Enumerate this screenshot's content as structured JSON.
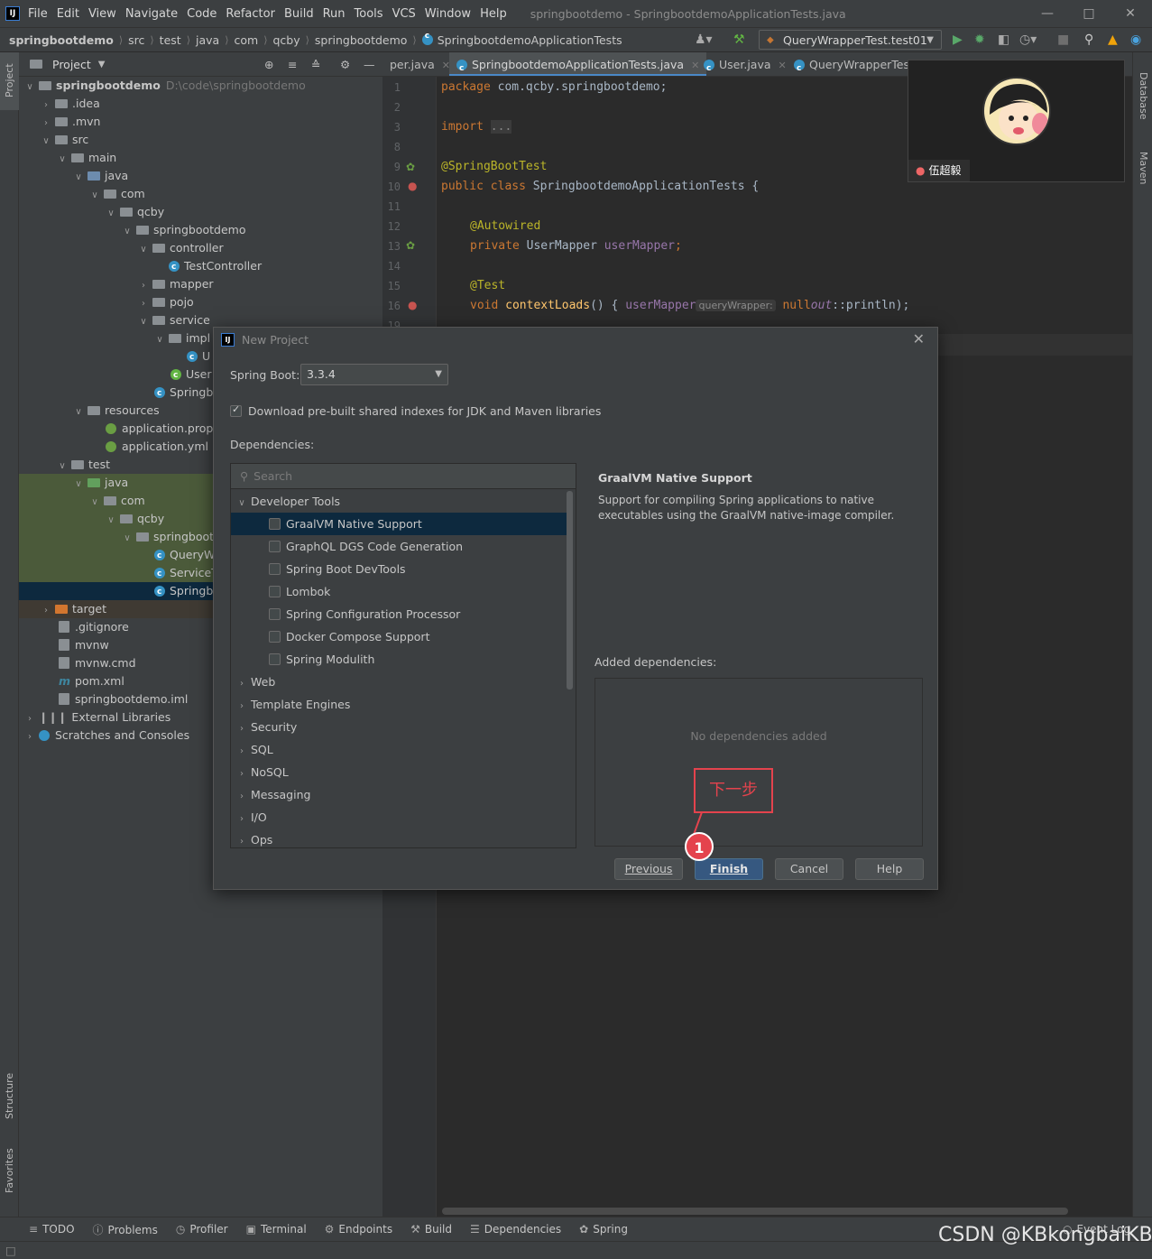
{
  "menubar": {
    "items": [
      "File",
      "Edit",
      "View",
      "Navigate",
      "Code",
      "Refactor",
      "Build",
      "Run",
      "Tools",
      "VCS",
      "Window",
      "Help"
    ],
    "window_title": "springbootdemo - SpringbootdemoApplicationTests.java"
  },
  "navbar": {
    "crumbs": [
      "springbootdemo",
      "src",
      "test",
      "java",
      "com",
      "qcby",
      "springbootdemo",
      "SpringbootdemoApplicationTests"
    ],
    "run_config": "QueryWrapperTest.test01"
  },
  "stripes": {
    "project": "Project",
    "structure": "Structure",
    "favorites": "Favorites",
    "database": "Database",
    "maven": "Maven"
  },
  "project": {
    "title": "Project",
    "rows": [
      {
        "label": "springbootdemo",
        "extra": "D:\\code\\springbootdemo"
      },
      {
        "label": ".idea"
      },
      {
        "label": ".mvn"
      },
      {
        "label": "src"
      },
      {
        "label": "main"
      },
      {
        "label": "java"
      },
      {
        "label": "com"
      },
      {
        "label": "qcby"
      },
      {
        "label": "springbootdemo"
      },
      {
        "label": "controller"
      },
      {
        "label": "TestController"
      },
      {
        "label": "mapper"
      },
      {
        "label": "pojo"
      },
      {
        "label": "service"
      },
      {
        "label": "impl"
      },
      {
        "label": "U"
      },
      {
        "label": "User"
      },
      {
        "label": "Springb"
      },
      {
        "label": "resources"
      },
      {
        "label": "application.prope"
      },
      {
        "label": "application.yml"
      },
      {
        "label": "test"
      },
      {
        "label": "java"
      },
      {
        "label": "com"
      },
      {
        "label": "qcby"
      },
      {
        "label": "springboot"
      },
      {
        "label": "QueryW"
      },
      {
        "label": "ServiceT"
      },
      {
        "label": "Springb"
      },
      {
        "label": "target"
      },
      {
        "label": ".gitignore"
      },
      {
        "label": "mvnw"
      },
      {
        "label": "mvnw.cmd"
      },
      {
        "label": "pom.xml"
      },
      {
        "label": "springbootdemo.iml"
      },
      {
        "label": "External Libraries"
      },
      {
        "label": "Scratches and Consoles"
      }
    ]
  },
  "editor": {
    "tabs": [
      "per.java",
      "SpringbootdemoApplicationTests.java",
      "User.java",
      "QueryWrapperTes"
    ],
    "line_numbers": [
      "1",
      "2",
      "3",
      "8",
      "9",
      "10",
      "11",
      "12",
      "13",
      "14",
      "15",
      "16",
      "19"
    ],
    "code": {
      "l1a": "package",
      "l1b": " com.qcby.springbootdemo;",
      "l3a": "import",
      "l3b": "...",
      "l9": "@SpringBootTest",
      "l10a": "public class",
      "l10b": " SpringbootdemoApplicationTests {",
      "l12": "@Autowired",
      "l13a": "private",
      "l13b": " UserMapper ",
      "l13c": "userMapper",
      ";": ";",
      "l15": "@Test",
      "l16a": "void",
      "l16b": "contextLoads",
      "l16c": "() { ",
      "l16d": "userMapper",
      ".sel": ".selectList(",
      "hint": "queryWrapper:",
      "l16e": "null",
      ".fe": ").forEach(System.",
      "out": "out",
      "tail": "::println);"
    }
  },
  "video": {
    "name": "伍超毅"
  },
  "dialog": {
    "title": "New Project",
    "spring_boot_label": "Spring Boot:",
    "spring_boot_value": "3.3.4",
    "download_label": "Download pre-built shared indexes for JDK and Maven libraries",
    "download_checked": true,
    "deps_label": "Dependencies:",
    "search_placeholder": "Search",
    "groups": [
      {
        "label": "Developer Tools",
        "expanded": true,
        "items": [
          "GraalVM Native Support",
          "GraphQL DGS Code Generation",
          "Spring Boot DevTools",
          "Lombok",
          "Spring Configuration Processor",
          "Docker Compose Support",
          "Spring Modulith"
        ]
      },
      {
        "label": "Web"
      },
      {
        "label": "Template Engines"
      },
      {
        "label": "Security"
      },
      {
        "label": "SQL"
      },
      {
        "label": "NoSQL"
      },
      {
        "label": "Messaging"
      },
      {
        "label": "I/O"
      },
      {
        "label": "Ops"
      }
    ],
    "selected_item": "GraalVM Native Support",
    "info_title": "GraalVM Native Support",
    "info_desc": "Support for compiling Spring applications to native executables using the GraalVM native-image compiler.",
    "added_label": "Added dependencies:",
    "added_empty": "No dependencies added",
    "buttons": {
      "previous": "Previous",
      "finish": "Finish",
      "cancel": "Cancel",
      "help": "Help"
    }
  },
  "annotation": {
    "box_text": "下一步",
    "badge": "1"
  },
  "bottombar": [
    "TODO",
    "Problems",
    "Profiler",
    "Terminal",
    "Endpoints",
    "Build",
    "Dependencies",
    "Spring"
  ],
  "event_log": "Event Log",
  "watermark": "CSDN @KBkongbaiKB",
  "colors": {
    "accent": "#365880",
    "annotation": "#e4434d",
    "selection": "#0d293e"
  }
}
